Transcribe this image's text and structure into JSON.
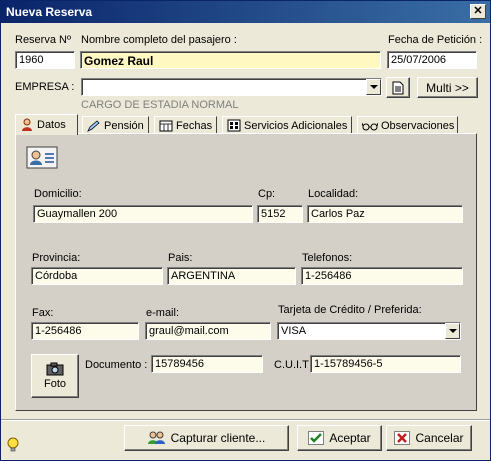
{
  "window": {
    "title": "Nueva Reserva",
    "close_symbol": "✕"
  },
  "header": {
    "reserva_label": "Reserva Nº",
    "reserva_value": "1960",
    "nombre_label": "Nombre completo del pasajero :",
    "nombre_value": "Gomez Raul",
    "fecha_label": "Fecha de Petición :",
    "fecha_value": "25/07/2006",
    "empresa_label": "EMPRESA :",
    "empresa_value": "",
    "multi_label": "Multi >>",
    "cargo_hint": "CARGO DE ESTADIA NORMAL"
  },
  "tabs": [
    {
      "label": "Datos",
      "icon": "person-icon",
      "active": true
    },
    {
      "label": "Pensión",
      "icon": "pencil-icon",
      "active": false
    },
    {
      "label": "Fechas",
      "icon": "calendar-icon",
      "active": false
    },
    {
      "label": "Servicios Adicionales",
      "icon": "services-icon",
      "active": false
    },
    {
      "label": "Observaciones",
      "icon": "glasses-icon",
      "active": false
    }
  ],
  "datos": {
    "domicilio_label": "Domicilio:",
    "domicilio_value": "Guaymallen 200",
    "cp_label": "Cp:",
    "cp_value": "5152",
    "localidad_label": "Localidad:",
    "localidad_value": "Carlos Paz",
    "provincia_label": "Provincia:",
    "provincia_value": "Córdoba",
    "pais_label": "Pais:",
    "pais_value": "ARGENTINA",
    "telefonos_label": "Telefonos:",
    "telefonos_value": "1-256486",
    "fax_label": "Fax:",
    "fax_value": "1-256486",
    "email_label": "e-mail:",
    "email_value": "graul@mail.com",
    "tarjeta_label": "Tarjeta de Crédito / Preferida:",
    "tarjeta_value": "VISA",
    "foto_label": "Foto",
    "documento_label": "Documento :",
    "documento_value": "15789456",
    "cuit_label": "C.U.I.T",
    "cuit_value": "1-15789456-5"
  },
  "footer": {
    "capturar_label": "Capturar cliente...",
    "aceptar_label": "Aceptar",
    "cancelar_label": "Cancelar"
  }
}
